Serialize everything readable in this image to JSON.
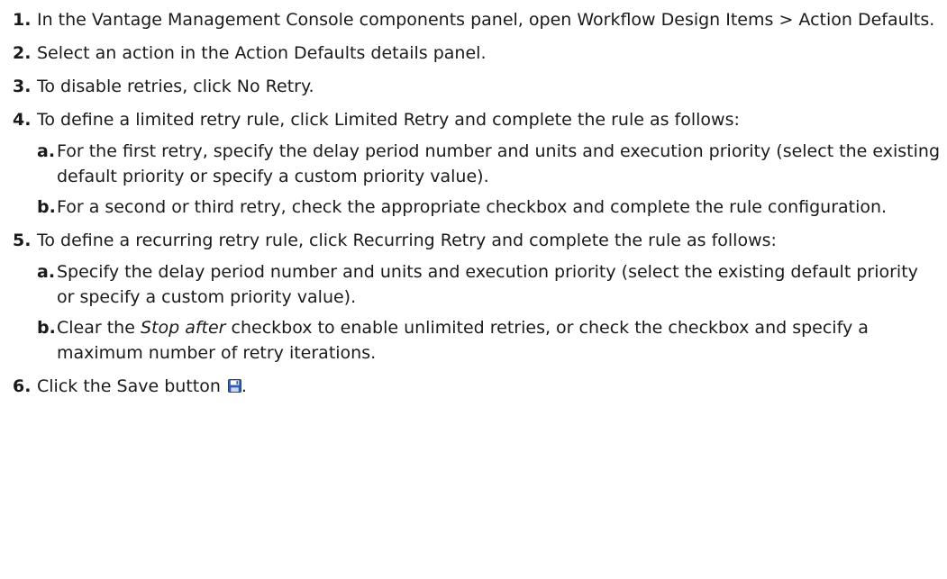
{
  "steps": [
    {
      "num": "1.",
      "text": "In the Vantage Management Console components panel, open Workflow Design Items > Action Defaults."
    },
    {
      "num": "2.",
      "text": "Select an action in the Action Defaults details panel."
    },
    {
      "num": "3.",
      "text": "To disable retries, click No Retry."
    },
    {
      "num": "4.",
      "text": "To define a limited retry rule, click Limited Retry and complete the rule as follows:",
      "sub": [
        {
          "num": "a.",
          "text": "For the first retry, specify the delay period number and units and execution priority (select the existing default priority or specify a custom priority value)."
        },
        {
          "num": "b.",
          "text": "For a second or third retry, check the appropriate checkbox and complete the rule configuration."
        }
      ]
    },
    {
      "num": "5.",
      "text": "To define a recurring retry rule, click Recurring Retry and complete the rule as follows:",
      "sub": [
        {
          "num": "a.",
          "text": "Specify the delay period number and units and execution priority (select the existing default priority or specify a custom priority value)."
        },
        {
          "num": "b.",
          "text_before": "Clear the ",
          "text_em": "Stop after",
          "text_after": " checkbox to enable unlimited retries, or check the checkbox and specify a maximum number of retry iterations."
        }
      ]
    },
    {
      "num": "6.",
      "text_before": "Click the Save button ",
      "icon": "save-icon",
      "text_after": "."
    }
  ]
}
